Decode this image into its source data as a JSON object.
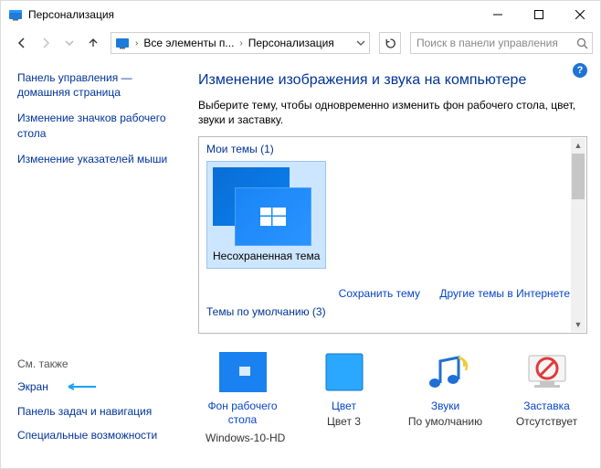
{
  "titlebar": {
    "title": "Персонализация"
  },
  "breadcrumb": {
    "seg1": "Все элементы п...",
    "seg2": "Персонализация"
  },
  "search": {
    "placeholder": "Поиск в панели управления"
  },
  "sidebar": {
    "home": "Панель управления — домашняя страница",
    "link_desktop_icons": "Изменение значков рабочего стола",
    "link_mouse_pointers": "Изменение указателей мыши"
  },
  "seealso": {
    "title": "См. также",
    "display": "Экран",
    "taskbar": "Панель задач и навигация",
    "ease": "Специальные возможности"
  },
  "content": {
    "title": "Изменение изображения и звука на компьютере",
    "desc": "Выберите тему, чтобы одновременно изменить фон рабочего стола, цвет, звуки и заставку.",
    "my_themes_label": "Мои темы (1)",
    "theme_name": "Несохраненная тема",
    "save_theme": "Сохранить тему",
    "more_themes": "Другие темы в Интернете",
    "default_themes_label": "Темы по умолчанию (3)"
  },
  "pers": {
    "bg_title": "Фон рабочего стола",
    "bg_sub": "Windows-10-HD",
    "color_title": "Цвет",
    "color_sub": "Цвет 3",
    "sound_title": "Звуки",
    "sound_sub": "По умолчанию",
    "saver_title": "Заставка",
    "saver_sub": "Отсутствует"
  }
}
